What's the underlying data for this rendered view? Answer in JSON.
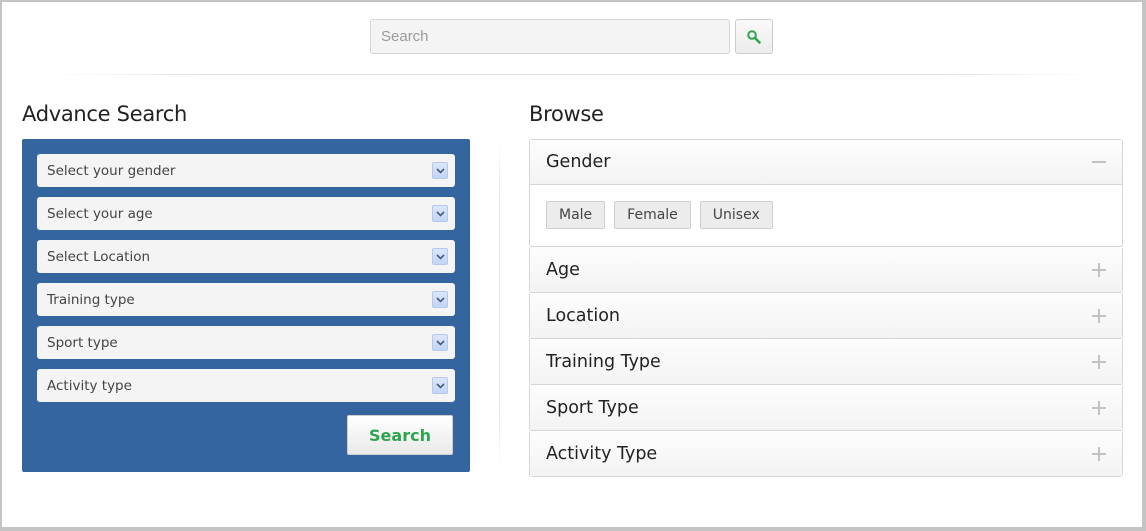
{
  "header": {
    "search_placeholder": "Search",
    "search_button_icon": "search-icon",
    "accent_color": "#2ea44f"
  },
  "advance_search": {
    "title": "Advance Search",
    "panel_color": "#35659f",
    "selects": [
      {
        "placeholder": "Select your gender"
      },
      {
        "placeholder": "Select your age"
      },
      {
        "placeholder": "Select Location"
      },
      {
        "placeholder": "Training type"
      },
      {
        "placeholder": "Sport type"
      },
      {
        "placeholder": "Activity type"
      }
    ],
    "search_label": "Search"
  },
  "browse": {
    "title": "Browse",
    "sections": [
      {
        "label": "Gender",
        "expanded": true,
        "icon": "minus-icon",
        "options": [
          "Male",
          "Female",
          "Unisex"
        ]
      },
      {
        "label": "Age",
        "expanded": false,
        "icon": "plus-icon"
      },
      {
        "label": "Location",
        "expanded": false,
        "icon": "plus-icon"
      },
      {
        "label": "Training Type",
        "expanded": false,
        "icon": "plus-icon"
      },
      {
        "label": "Sport Type",
        "expanded": false,
        "icon": "plus-icon"
      },
      {
        "label": "Activity Type",
        "expanded": false,
        "icon": "plus-icon"
      }
    ]
  }
}
